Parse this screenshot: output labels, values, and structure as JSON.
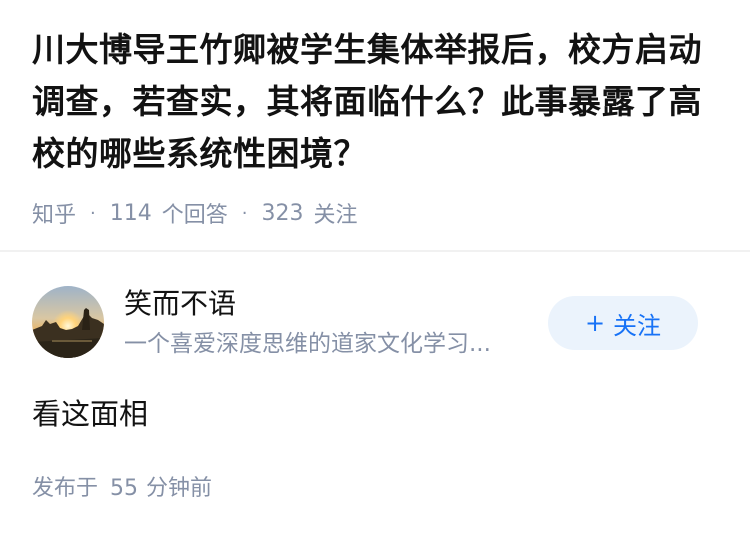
{
  "question": {
    "title": "川大博导王竹卿被学生集体举报后，校方启动调查，若查实，其将面临什么？此事暴露了高校的哪些系统性困境？",
    "source": "知乎",
    "separator": "·",
    "answer_count": "114",
    "answer_label": "个回答",
    "follower_count": "323",
    "follower_label": "关注"
  },
  "answer": {
    "author": {
      "name": "笑而不语",
      "bio": "一个喜爱深度思维的道家文化学习...",
      "avatar_icon": "sunset-avatar-icon"
    },
    "follow_button": {
      "plus": "+",
      "label": "关注"
    },
    "content": "看这面相",
    "published": {
      "prefix": "发布于",
      "value": "55",
      "suffix": "分钟前"
    }
  },
  "colors": {
    "title": "#121212",
    "meta": "#8590a6",
    "accent": "#1772f6",
    "follow_bg": "#ebf3fc"
  }
}
